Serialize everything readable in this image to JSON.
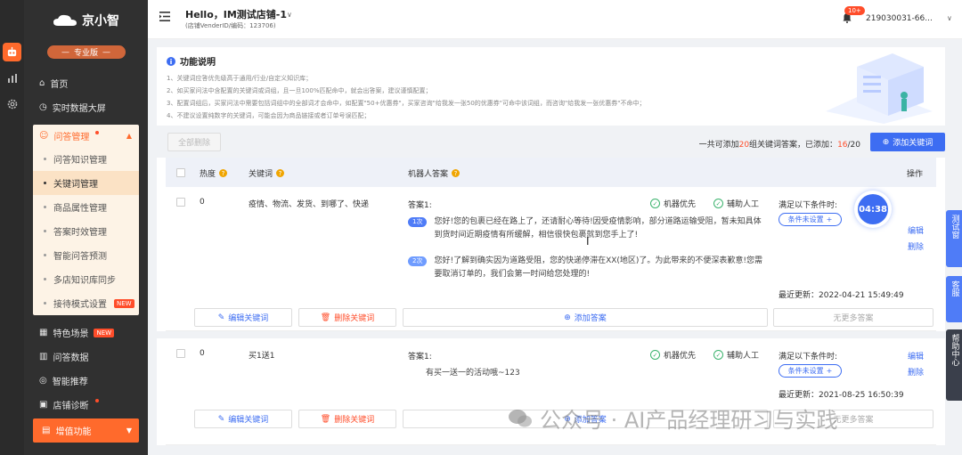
{
  "sidebar": {
    "logo_text": "京小智",
    "pro_label": "专业版",
    "nav_top": [
      {
        "label": "首页",
        "icon": "home-icon"
      },
      {
        "label": "实时数据大屏",
        "icon": "monitor-icon"
      }
    ],
    "group": {
      "label": "问答管理",
      "items": [
        {
          "label": "问答知识管理",
          "active": false
        },
        {
          "label": "关键词管理",
          "active": true
        },
        {
          "label": "商品属性管理",
          "active": false
        },
        {
          "label": "答案时效管理",
          "active": false
        },
        {
          "label": "智能问答预测",
          "active": false
        },
        {
          "label": "多店知识库同步",
          "active": false
        },
        {
          "label": "接待模式设置",
          "active": false,
          "tag": "NEW"
        }
      ]
    },
    "nav_bottom": [
      {
        "label": "特色场景",
        "tag": "NEW"
      },
      {
        "label": "问答数据"
      },
      {
        "label": "智能推荐"
      },
      {
        "label": "店铺诊断"
      }
    ],
    "value_added": "增值功能"
  },
  "header": {
    "shop_title": "Hello，IM测试店铺-1",
    "shop_sub": "(店铺VenderID/编码：123706)",
    "notify_badge": "10+",
    "user_name": "219030031-66..."
  },
  "info": {
    "title": "功能说明",
    "lines": [
      "1、关键词应答优先级高于通用/行业/自定义知识库；",
      "2、如买家问法中含配置的关键词或词组，且一旦100%匹配命中，就会出答案，建议谨慎配置；",
      "3、配置词组后，买家问法中需要包括词组中的全部词才会命中，如配置\"50+优惠券\"，买家咨询\"给我发一张50的优惠券\"可命中该词组，而咨询\"给我发一张优惠券\"不命中；",
      "4、不建议设置纯数字的关键词，可能会因为商品链接或者订单号误匹配；"
    ]
  },
  "actions": {
    "clear_all": "全部删除",
    "count_prefix": "一共可添加",
    "count_max": "20",
    "count_mid": "组关键词答案，已添加：",
    "count_current": "16",
    "count_suffix": "/20",
    "add_keyword": "添加关键词"
  },
  "table": {
    "headers": {
      "heat": "热度",
      "keyword": "关键词",
      "answer": "机器人答案",
      "ops": "操作"
    },
    "rows": [
      {
        "heat": "0",
        "keyword": "疫情、物流、发货、到哪了、快递",
        "answer_label": "答案1:",
        "robot_first": "机器优先",
        "manual_assist": "辅助人工",
        "replies": [
          {
            "tag": "1次",
            "text": "您好!您的包裹已经在路上了，还请耐心等待!因受疫情影响，部分道路运输受阻，暂未知具体到货时间近期疫情有所缓解，相信很快包裹就到您手上了!"
          },
          {
            "tag": "2次",
            "text": "您好!了解到确实因为道路受阻，您的快递停滞在XX(地区)了。为此带来的不便深表歉意!您需要取消订单的，我们会第一时间给您处理的!"
          }
        ],
        "cond_title": "满足以下条件时:",
        "cond_button": "条件未设置",
        "updated": "最近更新：2022-04-21 15:49:49",
        "edit": "编辑",
        "delete": "删除",
        "edit_kw": "编辑关键词",
        "delete_kw": "删除关键词",
        "add_answer": "添加答案",
        "no_more": "无更多答案"
      },
      {
        "heat": "0",
        "keyword": "买1送1",
        "answer_label": "答案1:",
        "robot_first": "机器优先",
        "manual_assist": "辅助人工",
        "replies": [
          {
            "tag": "",
            "text": "有买一送一的活动哦~123"
          }
        ],
        "cond_title": "满足以下条件时:",
        "cond_button": "条件未设置",
        "updated": "最近更新：2021-08-25 16:50:39",
        "edit": "编辑",
        "delete": "删除",
        "edit_kw": "编辑关键词",
        "delete_kw": "删除关键词",
        "add_answer": "添加答案",
        "no_more": "无更多答案"
      }
    ]
  },
  "timer": "04:38",
  "float_tabs": [
    "测试窗",
    "客服",
    "帮助中心"
  ],
  "watermark": "公众号 · AI产品经理研习与实践"
}
